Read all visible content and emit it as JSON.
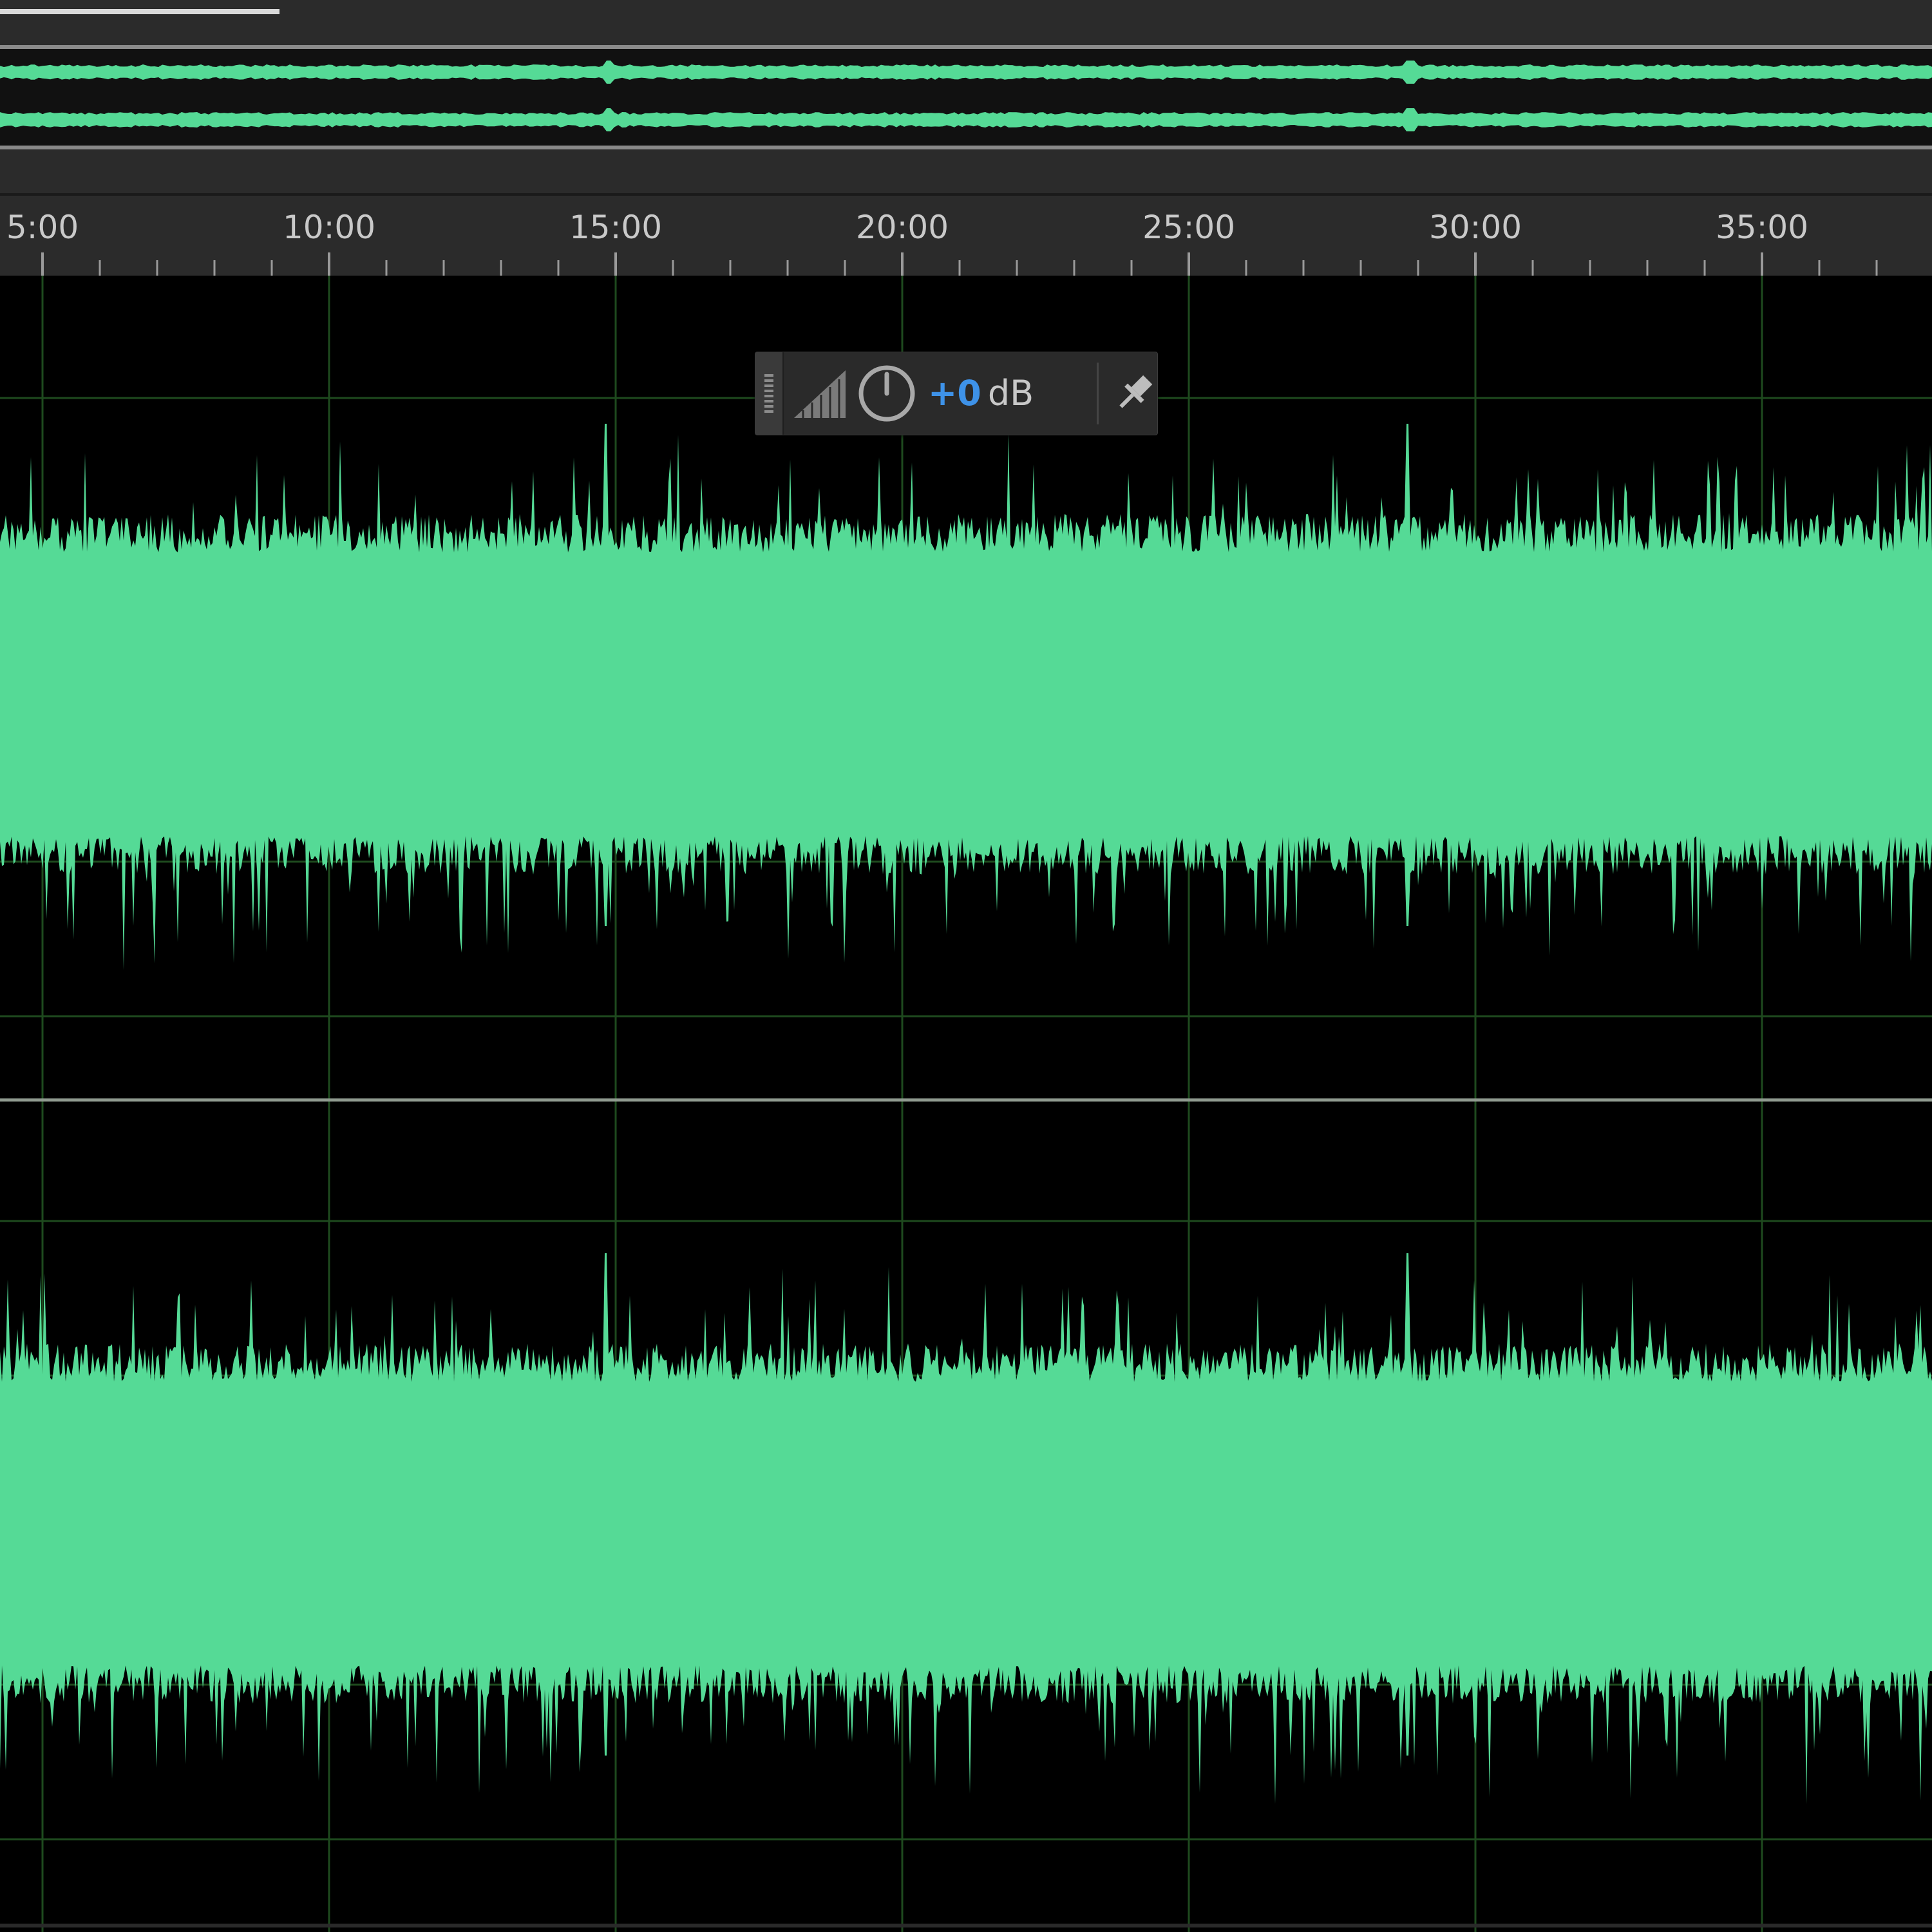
{
  "editor": {
    "waveform_color": "#55DA96",
    "grid_color": "#1E4A1E",
    "background_color": "#000000",
    "channels": 2
  },
  "ruler": {
    "labels": [
      "5:00",
      "10:00",
      "15:00",
      "20:00",
      "25:00",
      "30:00",
      "35:00"
    ]
  },
  "hud": {
    "gain_value": "+0",
    "gain_unit": "dB",
    "gain_color": "#3E92E8",
    "icons": [
      "grip-handle-icon",
      "amplitude-icon",
      "volume-knob-icon",
      "pin-icon"
    ]
  }
}
